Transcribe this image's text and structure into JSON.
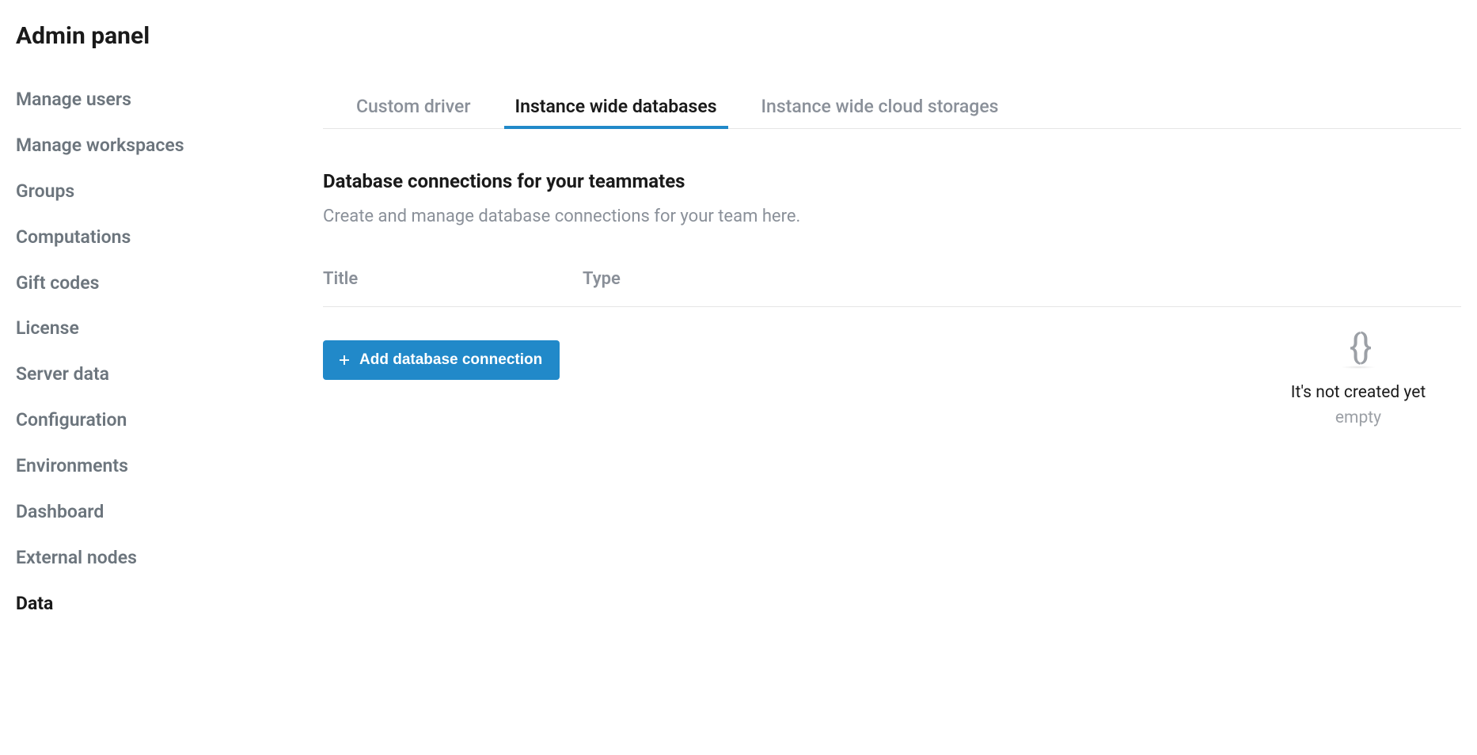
{
  "pageTitle": "Admin panel",
  "sidebar": {
    "items": [
      {
        "label": "Manage users",
        "active": false
      },
      {
        "label": "Manage workspaces",
        "active": false
      },
      {
        "label": "Groups",
        "active": false
      },
      {
        "label": "Computations",
        "active": false
      },
      {
        "label": "Gift codes",
        "active": false
      },
      {
        "label": "License",
        "active": false
      },
      {
        "label": "Server data",
        "active": false
      },
      {
        "label": "Configuration",
        "active": false
      },
      {
        "label": "Environments",
        "active": false
      },
      {
        "label": "Dashboard",
        "active": false
      },
      {
        "label": "External nodes",
        "active": false
      },
      {
        "label": "Data",
        "active": true
      }
    ]
  },
  "tabs": [
    {
      "label": "Custom driver",
      "active": false
    },
    {
      "label": "Instance wide databases",
      "active": true
    },
    {
      "label": "Instance wide cloud storages",
      "active": false
    }
  ],
  "section": {
    "title": "Database connections for your teammates",
    "subtitle": "Create and manage database connections for your team here."
  },
  "table": {
    "columns": [
      "Title",
      "Type"
    ]
  },
  "emptyState": {
    "iconGlyph": "{ }",
    "title": "It's not created yet",
    "subtitle": "empty"
  },
  "addButton": {
    "label": "Add database connection"
  },
  "colors": {
    "accent": "#2189c9",
    "textMuted": "#8a9099",
    "textPrimary": "#1a1a1a"
  }
}
